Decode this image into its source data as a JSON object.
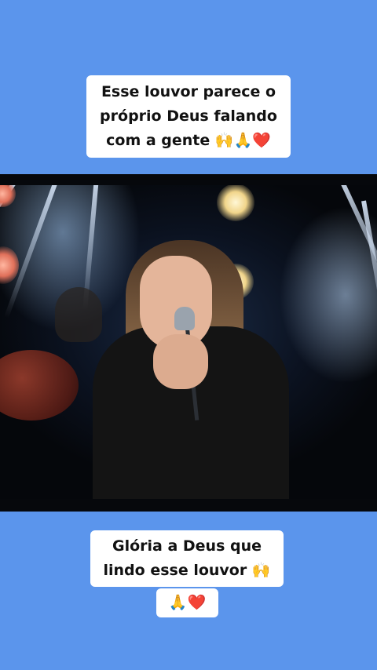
{
  "captions": {
    "top": {
      "line1": "Esse louvor parece o",
      "line2": "próprio Deus falando",
      "line3": "com a gente 🙌🙏❤️"
    },
    "bottom": {
      "line1": "Glória a Deus que",
      "line2": "lindo esse louvor 🙌",
      "line3": "🙏❤️"
    }
  },
  "video": {
    "description_icon": "music-video-frame"
  },
  "colors": {
    "background": "#5b95ec",
    "caption_bg": "#ffffff",
    "caption_text": "#111111",
    "video_bg": "#06080c"
  }
}
